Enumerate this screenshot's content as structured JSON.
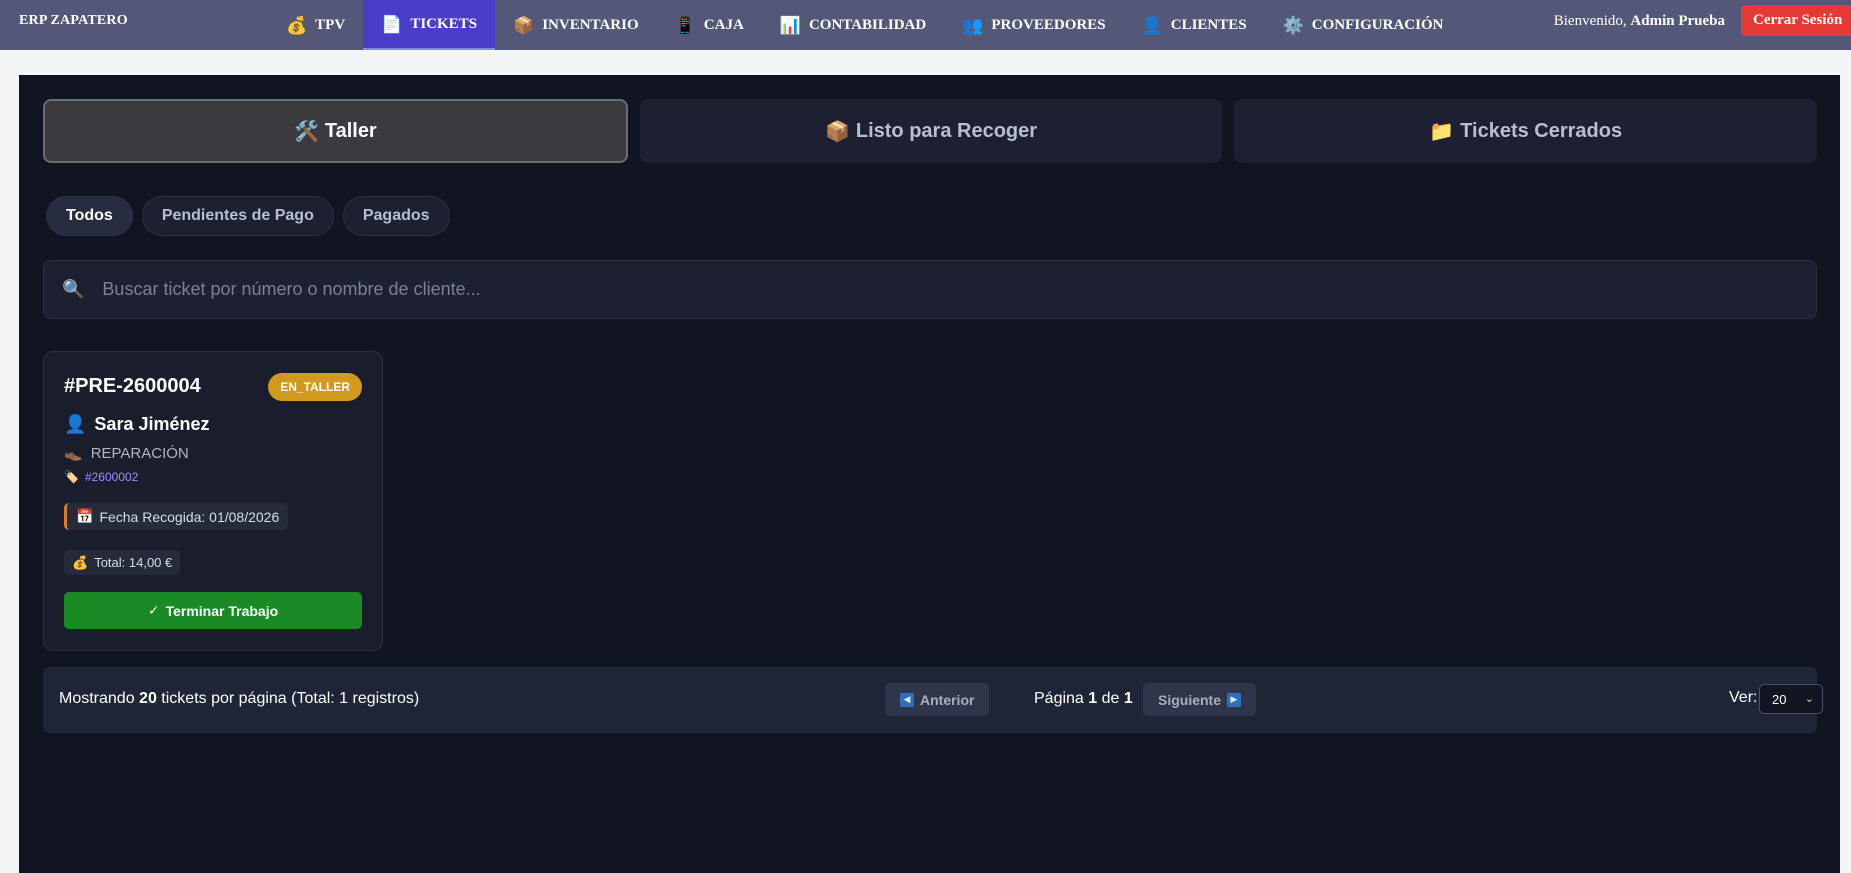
{
  "app": {
    "brand": "ERP ZAPATERO"
  },
  "nav": {
    "items": [
      {
        "label": "TPV",
        "icon": "💰"
      },
      {
        "label": "TICKETS",
        "icon": "📄"
      },
      {
        "label": "INVENTARIO",
        "icon": "📦"
      },
      {
        "label": "CAJA",
        "icon": "📱"
      },
      {
        "label": "CONTABILIDAD",
        "icon": "📊"
      },
      {
        "label": "PROVEEDORES",
        "icon": "👥"
      },
      {
        "label": "CLIENTES",
        "icon": "👤"
      },
      {
        "label": "CONFIGURACIÓN",
        "icon": "⚙️"
      }
    ],
    "active": "TICKETS"
  },
  "user": {
    "welcome_prefix": "Bienvenido,",
    "name": "Admin Prueba",
    "logout_label": "Cerrar Sesión"
  },
  "status_tabs": [
    {
      "icon": "🛠️",
      "label": "Taller"
    },
    {
      "icon": "📦",
      "label": "Listo para Recoger"
    },
    {
      "icon": "📁",
      "label": "Tickets Cerrados"
    }
  ],
  "filters": [
    "Todos",
    "Pendientes de Pago",
    "Pagados"
  ],
  "search": {
    "icon": "🔍",
    "placeholder": "Buscar ticket por número o nombre de cliente..."
  },
  "ticket": {
    "number": "#PRE-2600004",
    "status": "EN_TALLER",
    "client_icon": "👤",
    "client": "Sara Jiménez",
    "service_icon": "👞",
    "service": "REPARACIÓN",
    "ref_icon": "🏷️",
    "ref": "#2600002",
    "date_icon": "📅",
    "pickup_date": "Fecha Recogida: 01/08/2026",
    "total_icon": "💰",
    "total": "Total: 14,00 €",
    "action_icon": "✓",
    "action_label": "Terminar Trabajo"
  },
  "pagination": {
    "info_prefix": "Mostrando ",
    "per_page": "20",
    "info_middle": " tickets por página (Total: 1 registros)",
    "prev_icon": "◀",
    "prev_label": "Anterior",
    "page_prefix": "Página ",
    "current_page": "1",
    "page_middle": " de ",
    "total_pages": "1",
    "next_label": "Siguiente",
    "next_icon": "▶",
    "ver_label": "Ver:",
    "ver_value": "20"
  }
}
